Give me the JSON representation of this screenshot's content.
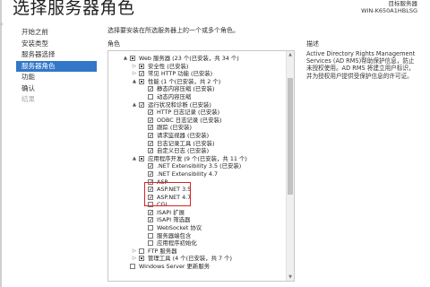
{
  "title": "选择服务器角色",
  "target_server_label": "目标服务器",
  "target_server": "WIN-K650A1HBLSG",
  "sidebar": [
    {
      "label": "开始之前",
      "state": "normal"
    },
    {
      "label": "安装类型",
      "state": "normal"
    },
    {
      "label": "服务器选择",
      "state": "normal"
    },
    {
      "label": "服务器角色",
      "state": "active"
    },
    {
      "label": "功能",
      "state": "normal"
    },
    {
      "label": "确认",
      "state": "normal"
    },
    {
      "label": "结果",
      "state": "disabled"
    }
  ],
  "intro": "选择要安装在所选服务器上的一个或多个角色。",
  "roles_header": "角色",
  "desc_header": "描述",
  "description": "Active Directory Rights Management Services (AD RMS)帮助保护信息，防止未授权使用。AD RMS 将建立用户标识，并为授权用户提供受保护信息的许可证。",
  "tree": [
    {
      "indent": 0,
      "expander": "▲",
      "check": "partial",
      "label": "Web 服务器 (23 个(已安装，共 34 个)"
    },
    {
      "indent": 1,
      "expander": "▷",
      "check": "partial",
      "label": "安全性 (已安装)"
    },
    {
      "indent": 1,
      "expander": "▷",
      "check": "checked",
      "label": "常见 HTTP 功能 (已安装)"
    },
    {
      "indent": 1,
      "expander": "▲",
      "check": "partial",
      "label": "性能 (1 个(已安装，共 2 个)"
    },
    {
      "indent": 2,
      "expander": "",
      "check": "checked",
      "label": "静态内容压缩 (已安装)"
    },
    {
      "indent": 2,
      "expander": "",
      "check": "unchecked",
      "label": "动态内容压缩"
    },
    {
      "indent": 1,
      "expander": "▲",
      "check": "checked",
      "label": "运行状况和诊断 (已安装)"
    },
    {
      "indent": 2,
      "expander": "",
      "check": "checked",
      "label": "HTTP 日志记录 (已安装)"
    },
    {
      "indent": 2,
      "expander": "",
      "check": "checked",
      "label": "ODBC 日志记录 (已安装)"
    },
    {
      "indent": 2,
      "expander": "",
      "check": "checked",
      "label": "跟踪 (已安装)"
    },
    {
      "indent": 2,
      "expander": "",
      "check": "checked",
      "label": "请求监视器 (已安装)"
    },
    {
      "indent": 2,
      "expander": "",
      "check": "checked",
      "label": "日志记录工具 (已安装)"
    },
    {
      "indent": 2,
      "expander": "",
      "check": "checked",
      "label": "自定义日志 (已安装)"
    },
    {
      "indent": 1,
      "expander": "▲",
      "check": "partial",
      "label": "应用程序开发 (9 个(已安装，共 11 个)"
    },
    {
      "indent": 2,
      "expander": "",
      "check": "checked",
      "label": ".NET Extensibility 3.5 (已安装)"
    },
    {
      "indent": 2,
      "expander": "",
      "check": "checked",
      "label": ".NET Extensibility 4.7"
    },
    {
      "indent": 2,
      "expander": "",
      "check": "checked",
      "label": "ASP"
    },
    {
      "indent": 2,
      "expander": "",
      "check": "checked",
      "label": "ASP.NET 3.5"
    },
    {
      "indent": 2,
      "expander": "",
      "check": "checked",
      "label": "ASP.NET 4.7"
    },
    {
      "indent": 2,
      "expander": "",
      "check": "unchecked",
      "label": "CGI"
    },
    {
      "indent": 2,
      "expander": "",
      "check": "checked",
      "label": "ISAPI 扩展"
    },
    {
      "indent": 2,
      "expander": "",
      "check": "checked",
      "label": "ISAPI 筛选器"
    },
    {
      "indent": 2,
      "expander": "",
      "check": "unchecked",
      "label": "WebSocket 协议"
    },
    {
      "indent": 2,
      "expander": "",
      "check": "unchecked",
      "label": "服务器端包含"
    },
    {
      "indent": 2,
      "expander": "",
      "check": "unchecked",
      "label": "应用程序初始化"
    },
    {
      "indent": 1,
      "expander": "▷",
      "check": "unchecked",
      "label": "FTP 服务器"
    },
    {
      "indent": 1,
      "expander": "▷",
      "check": "partial",
      "label": "管理工具 (4 个(已安装，共 7 个)"
    },
    {
      "indent": 0,
      "expander": "",
      "check": "unchecked",
      "label": "Windows Server 更新服务"
    }
  ]
}
